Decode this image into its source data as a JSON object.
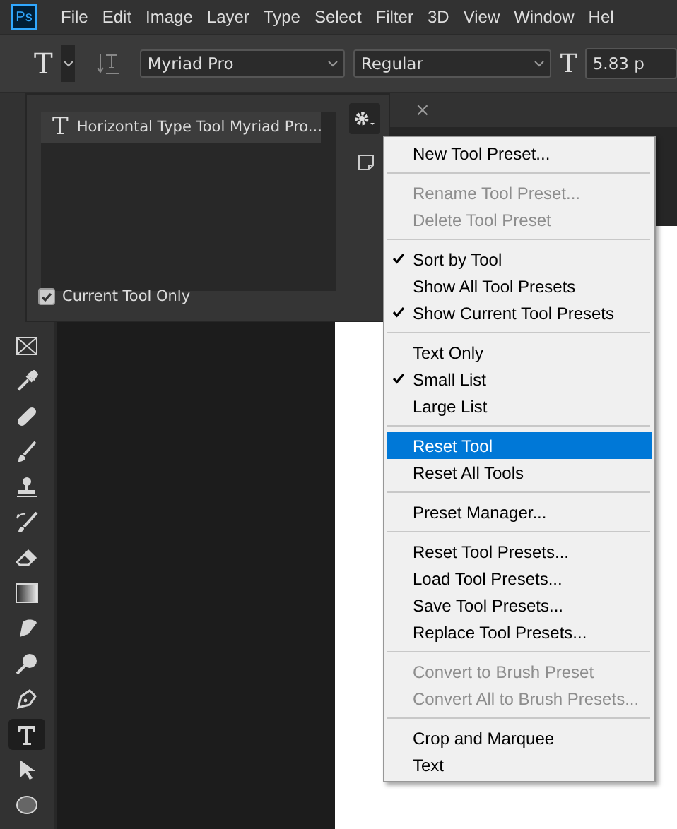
{
  "app_logo": "Ps",
  "menu_bar": [
    "File",
    "Edit",
    "Image",
    "Layer",
    "Type",
    "Select",
    "Filter",
    "3D",
    "View",
    "Window",
    "Hel"
  ],
  "options_bar": {
    "tool_glyph": "T",
    "font_family": "Myriad Pro",
    "font_style": "Regular",
    "size_glyph": "T",
    "font_size": "5.83 p"
  },
  "panel_tab": {
    "close": "×"
  },
  "tool_presets": {
    "items": [
      {
        "glyph": "T",
        "label": "Horizontal Type Tool Myriad Pro...",
        "selected": true
      }
    ],
    "current_tool_only": {
      "label": "Current Tool Only",
      "checked": true
    }
  },
  "toolbar": {
    "tools": [
      {
        "kind": "frame",
        "selected": false
      },
      {
        "kind": "eyedropper",
        "selected": false
      },
      {
        "kind": "bandage",
        "selected": false
      },
      {
        "kind": "brush",
        "selected": false
      },
      {
        "kind": "stamp",
        "selected": false
      },
      {
        "kind": "history",
        "selected": false
      },
      {
        "kind": "eraser",
        "selected": false
      },
      {
        "kind": "gradient",
        "selected": false
      },
      {
        "kind": "smudge",
        "selected": false
      },
      {
        "kind": "dodge",
        "selected": false
      },
      {
        "kind": "pen",
        "selected": false
      },
      {
        "kind": "type",
        "selected": true
      },
      {
        "kind": "arrow",
        "selected": false
      },
      {
        "kind": "ellipse",
        "selected": false
      }
    ]
  },
  "context_menu": {
    "groups": [
      [
        {
          "label": "New Tool Preset...",
          "checked": false,
          "disabled": false,
          "selected": false
        }
      ],
      [
        {
          "label": "Rename Tool Preset...",
          "checked": false,
          "disabled": true,
          "selected": false
        },
        {
          "label": "Delete Tool Preset",
          "checked": false,
          "disabled": true,
          "selected": false
        }
      ],
      [
        {
          "label": "Sort by Tool",
          "checked": true,
          "disabled": false,
          "selected": false
        },
        {
          "label": "Show All Tool Presets",
          "checked": false,
          "disabled": false,
          "selected": false
        },
        {
          "label": "Show Current Tool Presets",
          "checked": true,
          "disabled": false,
          "selected": false
        }
      ],
      [
        {
          "label": "Text Only",
          "checked": false,
          "disabled": false,
          "selected": false
        },
        {
          "label": "Small List",
          "checked": true,
          "disabled": false,
          "selected": false
        },
        {
          "label": "Large List",
          "checked": false,
          "disabled": false,
          "selected": false
        }
      ],
      [
        {
          "label": "Reset Tool",
          "checked": false,
          "disabled": false,
          "selected": true
        },
        {
          "label": "Reset All Tools",
          "checked": false,
          "disabled": false,
          "selected": false
        }
      ],
      [
        {
          "label": "Preset Manager...",
          "checked": false,
          "disabled": false,
          "selected": false
        }
      ],
      [
        {
          "label": "Reset Tool Presets...",
          "checked": false,
          "disabled": false,
          "selected": false
        },
        {
          "label": "Load Tool Presets...",
          "checked": false,
          "disabled": false,
          "selected": false
        },
        {
          "label": "Save Tool Presets...",
          "checked": false,
          "disabled": false,
          "selected": false
        },
        {
          "label": "Replace Tool Presets...",
          "checked": false,
          "disabled": false,
          "selected": false
        }
      ],
      [
        {
          "label": "Convert to Brush Preset",
          "checked": false,
          "disabled": true,
          "selected": false
        },
        {
          "label": "Convert All to Brush Presets...",
          "checked": false,
          "disabled": true,
          "selected": false
        }
      ],
      [
        {
          "label": "Crop and Marquee",
          "checked": false,
          "disabled": false,
          "selected": false
        },
        {
          "label": "Text",
          "checked": false,
          "disabled": false,
          "selected": false
        }
      ]
    ]
  }
}
